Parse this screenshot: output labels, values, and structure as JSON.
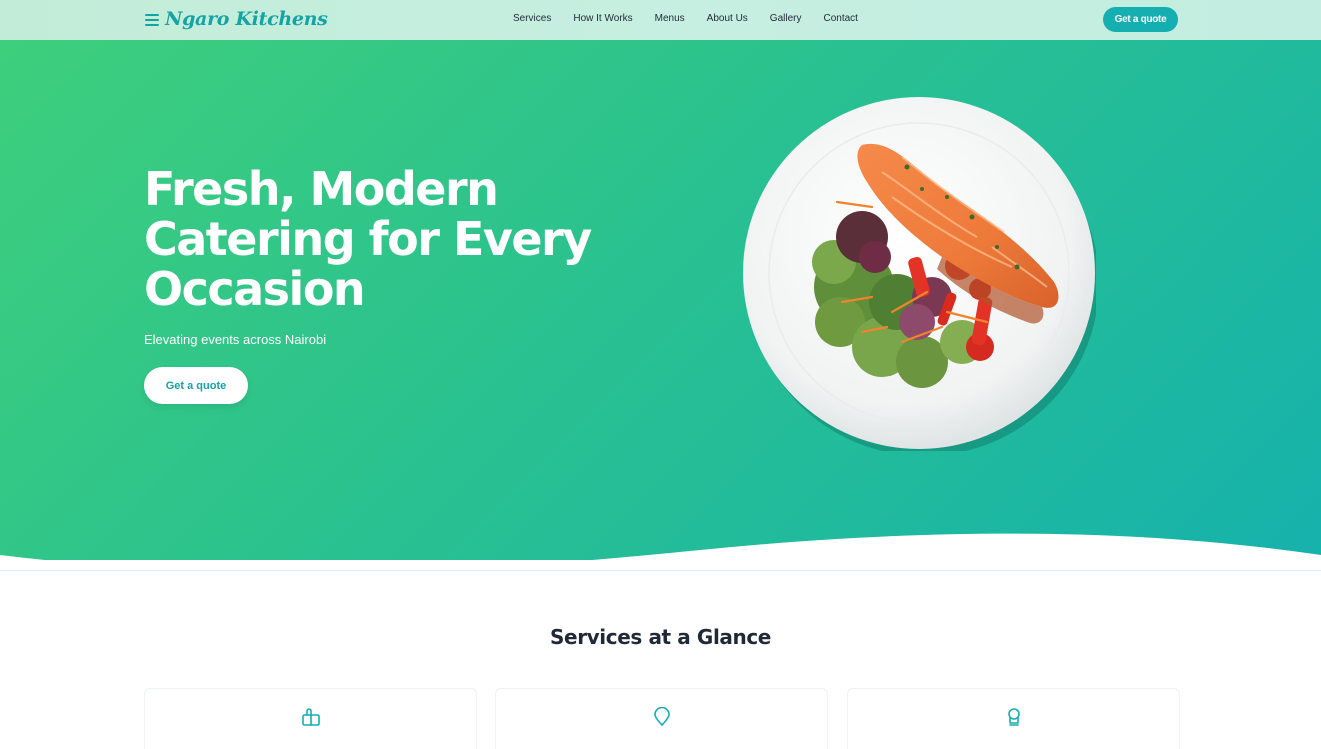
{
  "nav": {
    "brand": "Ngaro Kitchens",
    "links": [
      "Services",
      "How It Works",
      "Menus",
      "About Us",
      "Gallery",
      "Contact"
    ],
    "cta": "Get a quote"
  },
  "hero": {
    "title": "Fresh, Modern Catering for Every Occasion",
    "subtitle": "Elevating events across Nairobi",
    "cta": "Get a quote"
  },
  "services": {
    "title": "Services at a Glance",
    "cards": [
      {
        "icon": "gift-box-icon"
      },
      {
        "icon": "map-pin-icon"
      },
      {
        "icon": "chef-hat-icon"
      }
    ]
  },
  "colors": {
    "accent": "#15aeb1",
    "hero_start": "#3ecf7c",
    "hero_end": "#16b2ac"
  }
}
